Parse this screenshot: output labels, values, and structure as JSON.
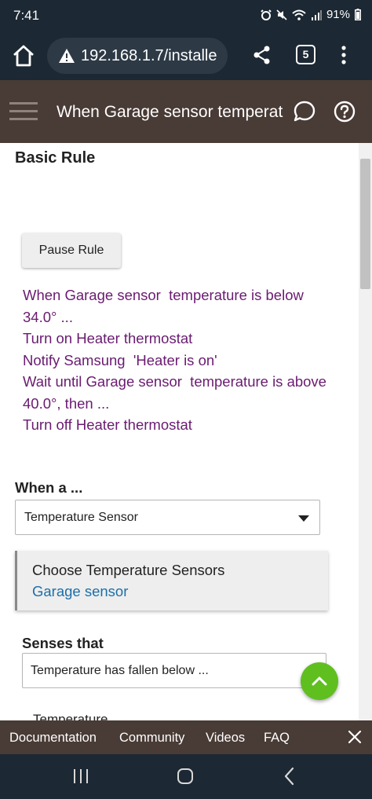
{
  "status_bar": {
    "time": "7:41",
    "battery": "91%"
  },
  "browser": {
    "url": "192.168.1.7/installe",
    "tab_count": "5"
  },
  "header": {
    "title": "When Garage sensor  temperat"
  },
  "rule": {
    "section_title": "Basic Rule",
    "pause_label": "Pause Rule",
    "lines": [
      "When Garage sensor  temperature is below 34.0° ...",
      "Turn on Heater thermostat",
      "Notify Samsung  'Heater is on'",
      "Wait until Garage sensor  temperature is above 40.0°, then ...",
      "Turn off Heater thermostat"
    ]
  },
  "trigger": {
    "when_label": "When a ...",
    "device_type": "Temperature Sensor",
    "choose_title": "Choose Temperature Sensors",
    "chosen_device": "Garage sensor",
    "senses_label": "Senses that",
    "senses_value": "Temperature has fallen below ...",
    "next_label": "Temperature"
  },
  "footer": {
    "links": [
      "Documentation",
      "Community",
      "Videos",
      "FAQ"
    ]
  },
  "colors": {
    "header_bg": "#493b35",
    "rule_text": "#6a1b71",
    "link": "#1c6fa8",
    "fab": "#5fbf1f"
  }
}
